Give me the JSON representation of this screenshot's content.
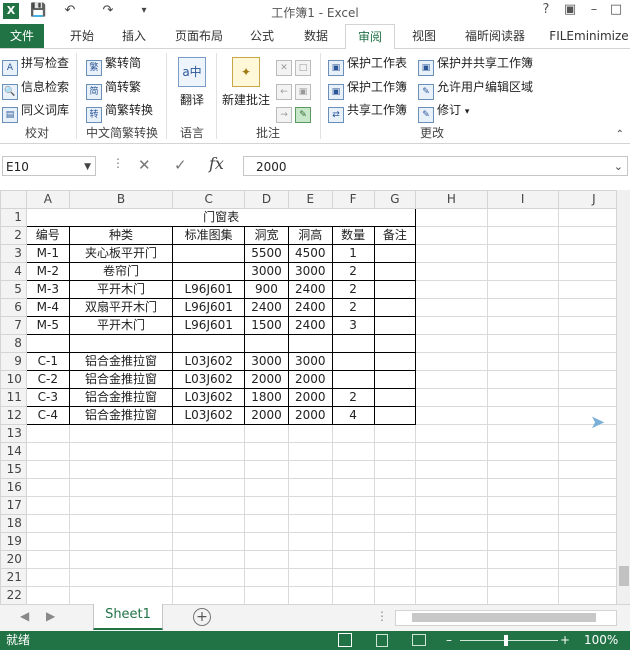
{
  "window": {
    "title": "工作簿1 - Excel",
    "app_icon": "excel-icon"
  },
  "tabs": [
    "文件",
    "开始",
    "插入",
    "页面布局",
    "公式",
    "数据",
    "审阅",
    "视图",
    "福昕阅读器",
    "FILEminimize"
  ],
  "active_tab": "审阅",
  "ribbon": {
    "proofing": {
      "items": [
        "拼写检查",
        "信息检索",
        "同义词库"
      ],
      "label": "校对"
    },
    "chinese": {
      "items": [
        "繁转简",
        "简转繁",
        "简繁转换"
      ],
      "label": "中文简繁转换"
    },
    "language": {
      "button": "翻译",
      "label": "语言"
    },
    "comments": {
      "button": "新建批注",
      "label": "批注"
    },
    "changes": {
      "items": [
        "保护工作表",
        "保护工作簿",
        "共享工作簿",
        "保护并共享工作簿",
        "允许用户编辑区域",
        "修订"
      ],
      "label": "更改"
    }
  },
  "formula_bar": {
    "name_box": "E10",
    "fx": "fx",
    "value": "2000"
  },
  "columns": [
    "A",
    "B",
    "C",
    "D",
    "E",
    "F",
    "G",
    "H",
    "I",
    "J"
  ],
  "sheet": {
    "title": "门窗表",
    "headers": [
      "编号",
      "种类",
      "标准图集",
      "洞宽",
      "洞高",
      "数量",
      "备注"
    ],
    "rows": [
      [
        "M-1",
        "夹心板平开门",
        "",
        "5500",
        "4500",
        "1",
        ""
      ],
      [
        "M-2",
        "卷帘门",
        "",
        "3000",
        "3000",
        "2",
        ""
      ],
      [
        "M-3",
        "平开木门",
        "L96J601",
        "900",
        "2400",
        "2",
        ""
      ],
      [
        "M-4",
        "双扇平开木门",
        "L96J601",
        "2400",
        "2400",
        "2",
        ""
      ],
      [
        "M-5",
        "平开木门",
        "L96J601",
        "1500",
        "2400",
        "3",
        ""
      ],
      [
        "",
        "",
        "",
        "",
        "",
        "",
        ""
      ],
      [
        "C-1",
        "铝合金推拉窗",
        "L03J602",
        "3000",
        "3000",
        "",
        ""
      ],
      [
        "C-2",
        "铝合金推拉窗",
        "L03J602",
        "2000",
        "2000",
        "",
        ""
      ],
      [
        "C-3",
        "铝合金推拉窗",
        "L03J602",
        "1800",
        "2000",
        "2",
        ""
      ],
      [
        "C-4",
        "铝合金推拉窗",
        "L03J602",
        "2000",
        "2000",
        "4",
        ""
      ]
    ],
    "row_numbers": [
      "1",
      "2",
      "3",
      "4",
      "5",
      "6",
      "7",
      "8",
      "9",
      "10",
      "11",
      "12",
      "13",
      "14",
      "15",
      "16",
      "17",
      "18",
      "19",
      "20",
      "21",
      "22"
    ]
  },
  "sheet_tab": "Sheet1",
  "status": {
    "left": "就绪",
    "zoom": "100%"
  }
}
